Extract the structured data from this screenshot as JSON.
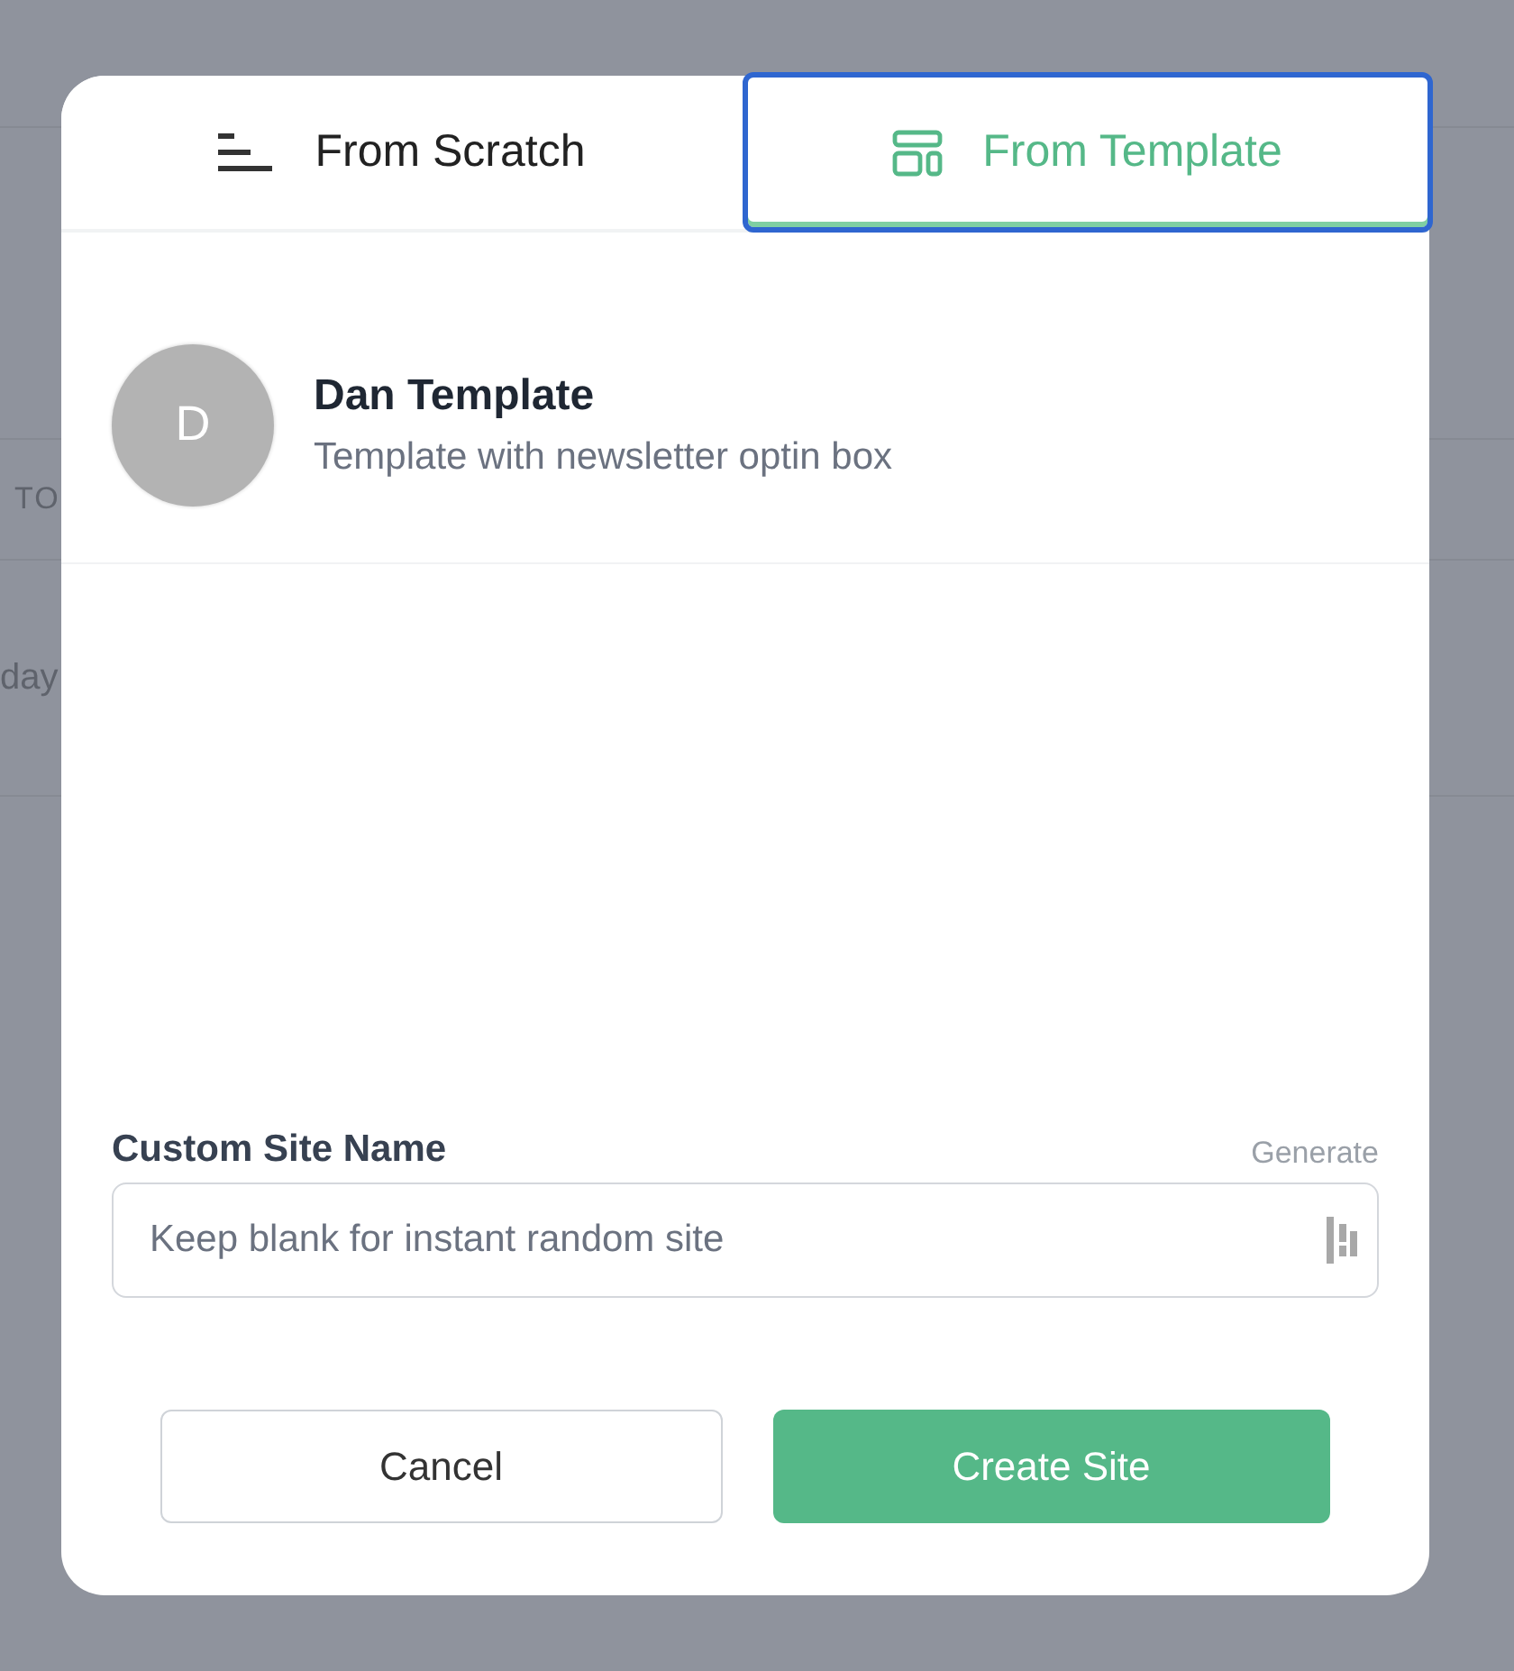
{
  "background": {
    "rows": [
      {
        "text": "TO",
        "kind": "heading"
      },
      {
        "text": "day",
        "kind": "cell"
      }
    ]
  },
  "tabs": [
    {
      "label": "From Scratch",
      "selected": false
    },
    {
      "label": "From Template",
      "selected": true
    }
  ],
  "templates": [
    {
      "initial": "D",
      "name": "Dan Template",
      "description": "Template with newsletter optin box"
    }
  ],
  "site_name": {
    "label": "Custom Site Name",
    "action": "Generate",
    "placeholder": "Keep blank for instant random site"
  },
  "buttons": [
    {
      "label": "Cancel",
      "kind": "secondary"
    },
    {
      "label": "Create Site",
      "kind": "primary"
    }
  ]
}
